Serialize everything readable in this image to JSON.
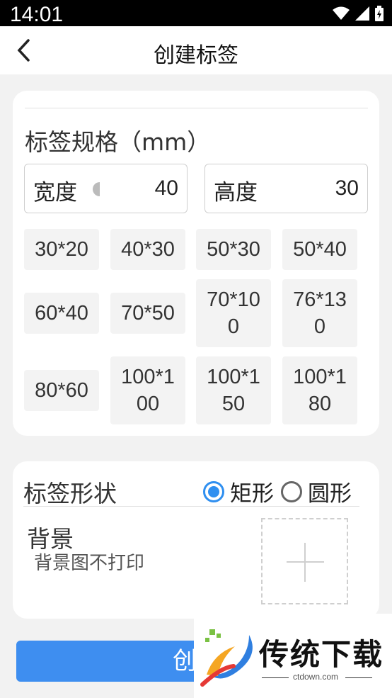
{
  "status": {
    "time": "14:01"
  },
  "appbar": {
    "title": "创建标签"
  },
  "spec": {
    "title": "标签规格（mm）",
    "width": {
      "label": "宽度",
      "value": "40"
    },
    "height": {
      "label": "高度",
      "value": "30"
    },
    "sizes": [
      "30*20",
      "40*30",
      "50*30",
      "50*40",
      "60*40",
      "70*50",
      "70*10\n0",
      "76*13\n0",
      "80*60",
      "100*1\n00",
      "100*1\n50",
      "100*1\n80"
    ]
  },
  "shape": {
    "title": "标签形状",
    "options": [
      "矩形",
      "圆形"
    ],
    "selected": "矩形"
  },
  "background": {
    "title": "背景",
    "subtitle": "背景图不打印"
  },
  "create_button": "创建",
  "watermark": {
    "brand": "传统下载",
    "site": "ctdown.com"
  }
}
